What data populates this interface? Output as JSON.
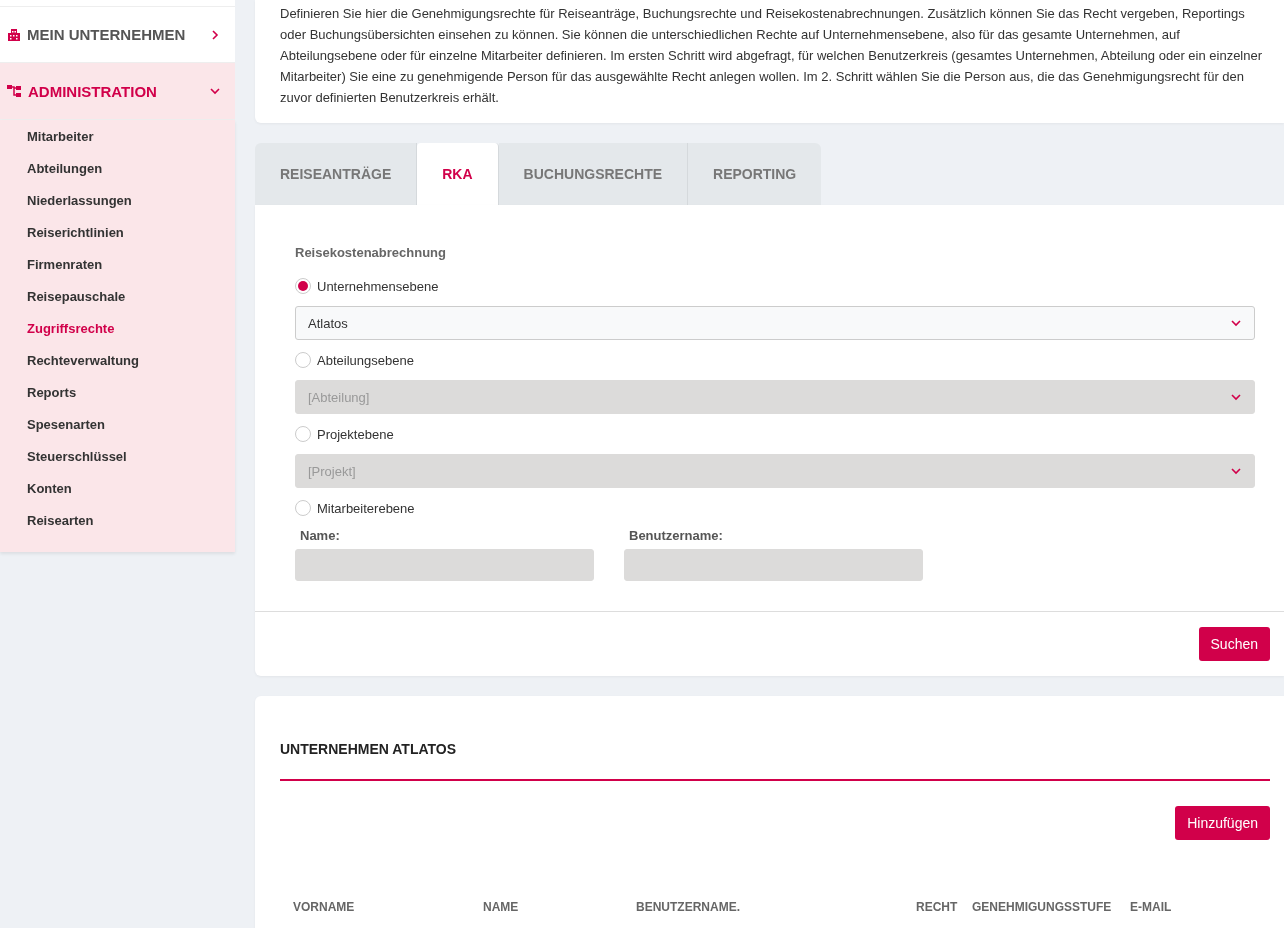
{
  "sidebar": {
    "sections": [
      {
        "title": "MEIN UNTERNEHMEN",
        "kind": "company",
        "expanded": false
      },
      {
        "title": "ADMINISTRATION",
        "kind": "admin",
        "expanded": true,
        "items": [
          {
            "label": "Mitarbeiter",
            "selected": false
          },
          {
            "label": "Abteilungen",
            "selected": false
          },
          {
            "label": "Niederlassungen",
            "selected": false
          },
          {
            "label": "Reiserichtlinien",
            "selected": false
          },
          {
            "label": "Firmenraten",
            "selected": false
          },
          {
            "label": "Reisepauschale",
            "selected": false
          },
          {
            "label": "Zugriffsrechte",
            "selected": true
          },
          {
            "label": "Rechteverwaltung",
            "selected": false
          },
          {
            "label": "Reports",
            "selected": false
          },
          {
            "label": "Spesenarten",
            "selected": false
          },
          {
            "label": "Steuerschlüssel",
            "selected": false
          },
          {
            "label": "Konten",
            "selected": false
          },
          {
            "label": "Reisearten",
            "selected": false
          }
        ]
      }
    ]
  },
  "intro": "Definieren Sie hier die Genehmigungsrechte für Reiseanträge, Buchungsrechte und Reisekostenabrechnungen. Zusätzlich können Sie das Recht vergeben, Reportings oder Buchungsübersichten einsehen zu können. Sie können die unterschiedlichen Rechte auf Unternehmensebene, also für das gesamte Unternehmen, auf Abteilungsebene oder für einzelne Mitarbeiter definieren. Im ersten Schritt wird abgefragt, für welchen Benutzerkreis (gesamtes Unternehmen, Abteilung oder ein einzelner Mitarbeiter) Sie eine zu genehmigende Person für das ausgewählte Recht anlegen wollen. Im 2. Schritt wählen Sie die Person aus, die das Genehmigungsrecht für den zuvor definierten Benutzerkreis erhält.",
  "tabs": [
    {
      "label": "REISEANTRÄGE",
      "selected": false
    },
    {
      "label": "RKA",
      "selected": true
    },
    {
      "label": "BUCHUNGSRECHTE",
      "selected": false
    },
    {
      "label": "REPORTING",
      "selected": false
    }
  ],
  "form": {
    "title": "Reisekostenabrechnung",
    "options": [
      {
        "kind": "select",
        "label": "Unternehmensebene",
        "selected": true,
        "value": "Atlatos",
        "disabled": false
      },
      {
        "kind": "select",
        "label": "Abteilungsebene",
        "selected": false,
        "placeholder": "[Abteilung]",
        "disabled": true
      },
      {
        "kind": "select",
        "label": "Projektebene",
        "selected": false,
        "placeholder": "[Projekt]",
        "disabled": true
      },
      {
        "kind": "fields",
        "label": "Mitarbeiterebene",
        "selected": false,
        "fields": [
          {
            "label": "Name:",
            "disabled": true
          },
          {
            "label": "Benutzername:",
            "disabled": true
          }
        ]
      }
    ],
    "button": "Suchen"
  },
  "results": {
    "title": "UNTERNEHMEN ATLATOS",
    "button": "Hinzufügen",
    "columns": [
      "VORNAME",
      "NAME",
      "BENUTZERNAME.",
      "RECHT",
      "GENEHMIGUNGSSTUFE",
      "E-MAIL"
    ]
  }
}
